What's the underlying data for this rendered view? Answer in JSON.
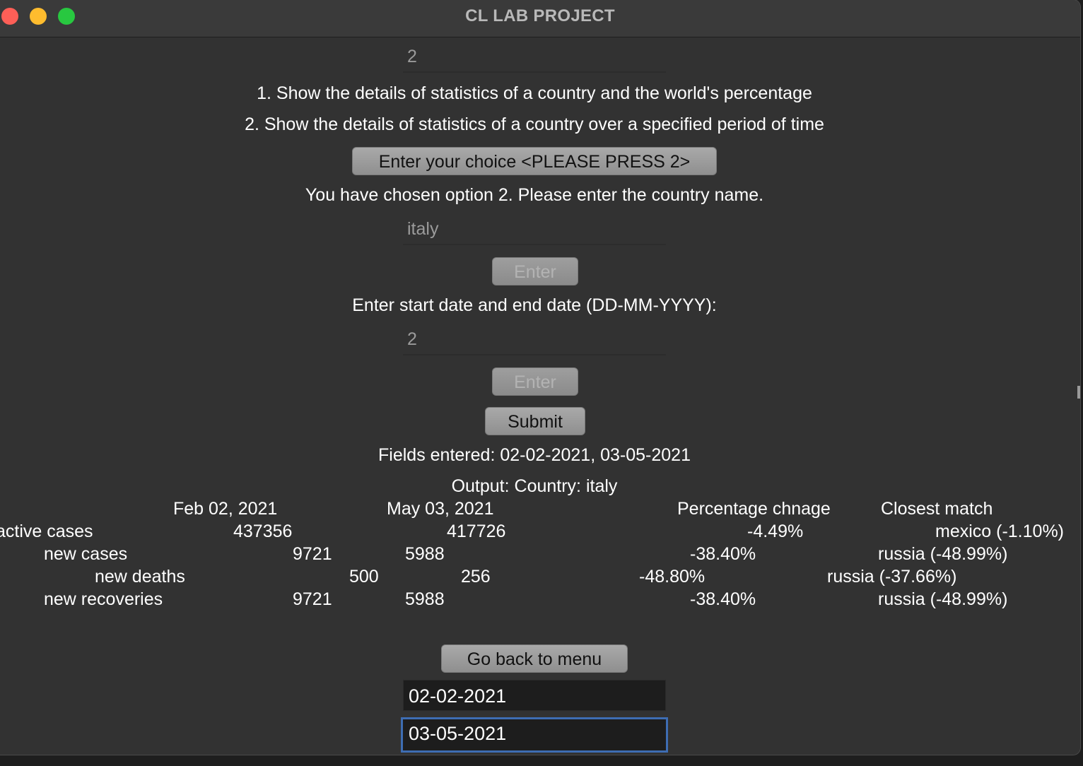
{
  "window": {
    "title": "CL LAB PROJECT"
  },
  "menu_choice_input": {
    "value": "2"
  },
  "menu": {
    "option1": "1. Show the details of statistics of a country and the world's percentage",
    "option2": "2. Show the details of statistics of a country over a specified period of time"
  },
  "choice_button": {
    "label": "Enter your choice <PLEASE PRESS 2>"
  },
  "prompt_country": "You have chosen option 2. Please enter the country name.",
  "country_input": {
    "value": "italy"
  },
  "country_enter_button": {
    "label": "Enter"
  },
  "prompt_dates": "Enter start date and end date (DD-MM-YYYY):",
  "date_count_input": {
    "value": "2"
  },
  "date_enter_button": {
    "label": "Enter"
  },
  "submit_button": {
    "label": "Submit"
  },
  "fields_entered": "Fields entered: 02-02-2021, 03-05-2021",
  "output_heading": "Output: Country: italy",
  "table": {
    "headers": [
      "Feb 02, 2021",
      "May 03, 2021",
      "Percentage chnage",
      "Closest match"
    ],
    "rows": [
      {
        "label": "active cases",
        "start": "437356",
        "end": "417726",
        "change": "-4.49%",
        "closest": "mexico (-1.10%)"
      },
      {
        "label": "new cases",
        "start": "9721",
        "end": "5988",
        "change": "-38.40%",
        "closest": "russia (-48.99%)"
      },
      {
        "label": "new deaths",
        "start": "500",
        "end": "256",
        "change": "-48.80%",
        "closest": "russia (-37.66%)"
      },
      {
        "label": "new recoveries",
        "start": "9721",
        "end": "5988",
        "change": "-38.40%",
        "closest": "russia (-48.99%)"
      }
    ]
  },
  "back_button": {
    "label": "Go back to menu"
  },
  "start_date_input": {
    "value": "02-02-2021"
  },
  "end_date_input": {
    "value": "03-05-2021"
  }
}
